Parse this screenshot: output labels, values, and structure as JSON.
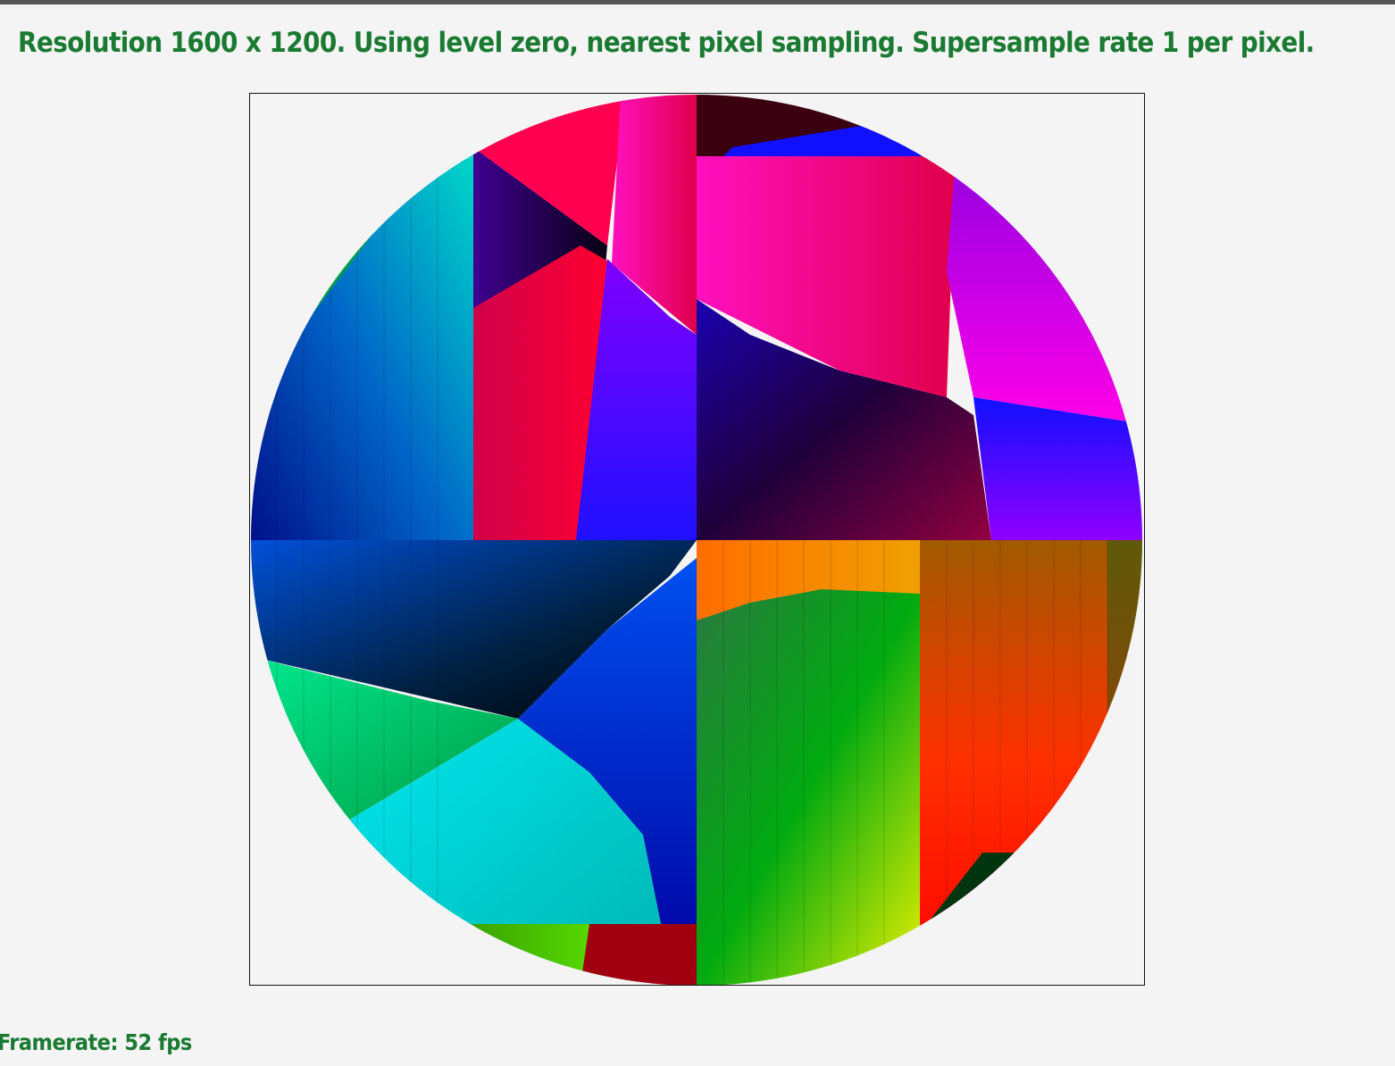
{
  "status": {
    "text": "Resolution 1600 x 1200. Using level zero, nearest pixel sampling. Supersample rate 1 per pixel.",
    "color": "#1a7a32"
  },
  "footer": {
    "framerate_text": "Framerate: 52 fps"
  },
  "viewport": {
    "background": "#f4f4f4",
    "border_color": "#111111"
  }
}
